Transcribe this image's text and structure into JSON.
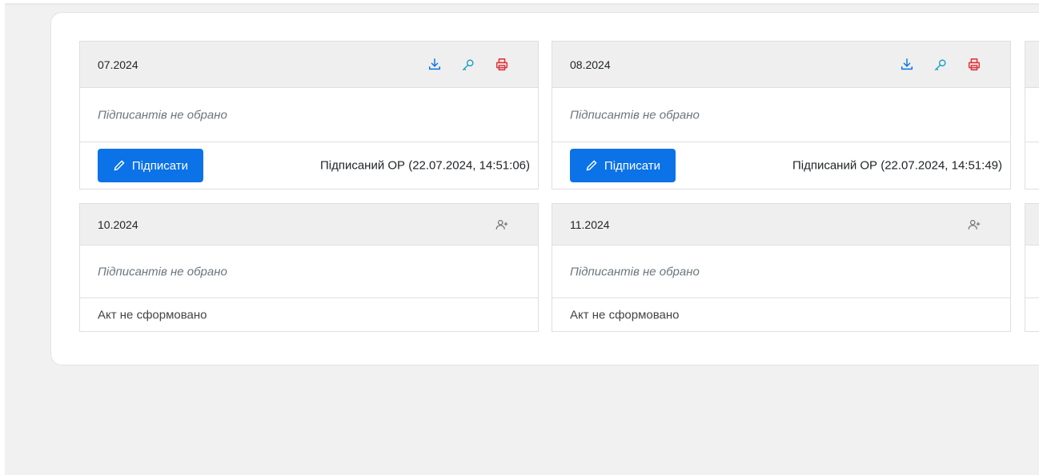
{
  "colors": {
    "accent": "#0b72e7",
    "print": "#e0343b",
    "key": "#1ea0c7",
    "muted": "#6c757d"
  },
  "cards": [
    {
      "period": "07.2024",
      "icons": [
        "download-icon",
        "key-icon",
        "print-icon"
      ],
      "signers": "Підписантів не обрано",
      "sign_label": "Підписати",
      "status": "Підписаний ОР (22.07.2024, 14:51:06)"
    },
    {
      "period": "08.2024",
      "icons": [
        "download-icon",
        "key-icon",
        "print-icon"
      ],
      "signers": "Підписантів не обрано",
      "sign_label": "Підписати",
      "status": "Підписаний ОР (22.07.2024, 14:51:49)"
    },
    {
      "period": "10.2024",
      "icons": [
        "add-user-icon"
      ],
      "signers": "Підписантів не обрано",
      "act_status": "Акт не сформовано"
    },
    {
      "period": "11.2024",
      "icons": [
        "add-user-icon"
      ],
      "signers": "Підписантів не обрано",
      "act_status": "Акт не сформовано"
    }
  ]
}
